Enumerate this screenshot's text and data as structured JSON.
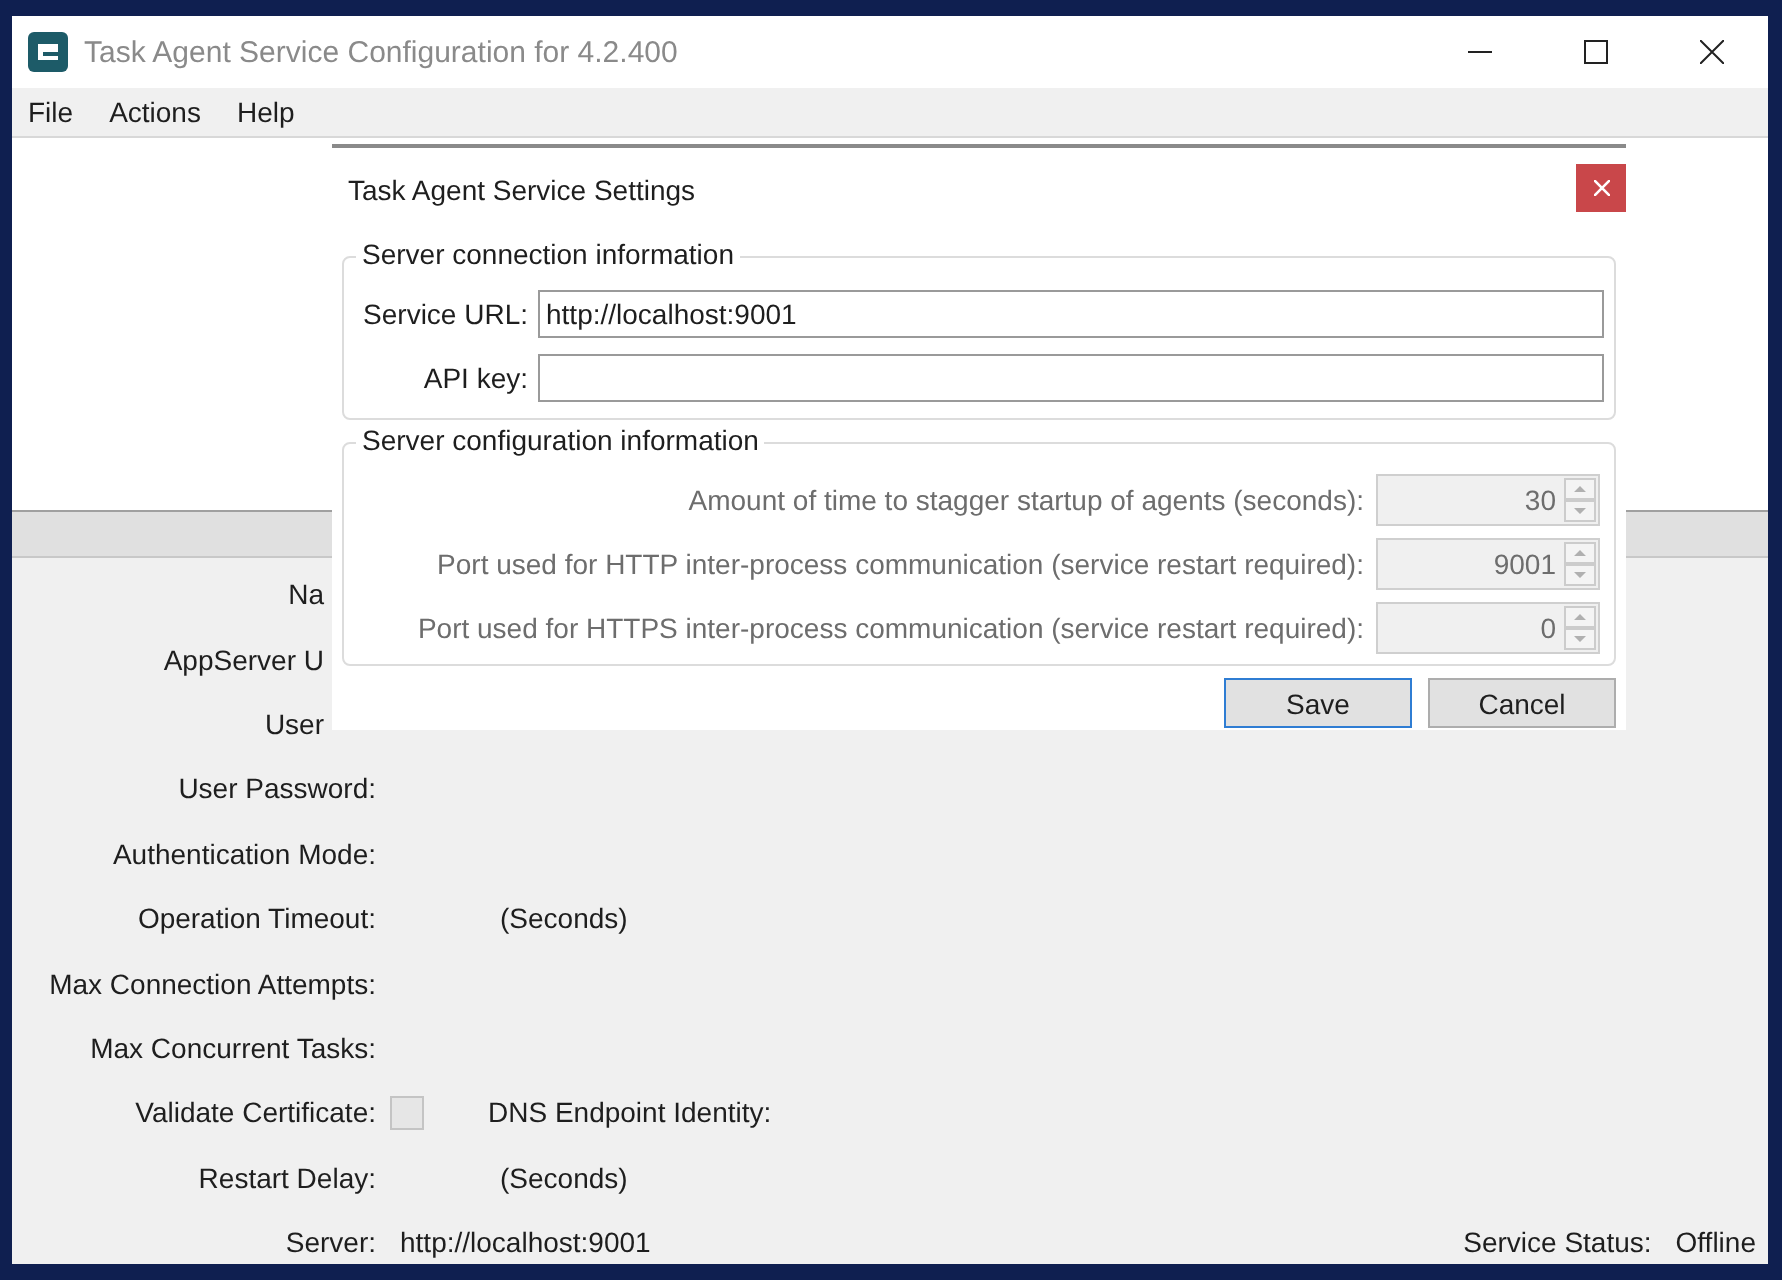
{
  "window": {
    "title": "Task Agent Service Configuration for 4.2.400"
  },
  "menu": [
    "File",
    "Actions",
    "Help"
  ],
  "form": {
    "rows": [
      {
        "kind": "clipped",
        "label": "Na"
      },
      {
        "kind": "clipped",
        "label": "AppServer U"
      },
      {
        "kind": "clipped",
        "label": "User"
      },
      {
        "kind": "plain",
        "label": "User Password:"
      },
      {
        "kind": "plain",
        "label": "Authentication Mode:"
      },
      {
        "kind": "suffix",
        "label": "Operation Timeout:",
        "suffix": "(Seconds)"
      },
      {
        "kind": "plain",
        "label": "Max Connection Attempts:"
      },
      {
        "kind": "plain",
        "label": "Max Concurrent Tasks:"
      },
      {
        "kind": "checkbox",
        "label": "Validate Certificate:",
        "checked": false,
        "extra_label": "DNS Endpoint Identity:"
      },
      {
        "kind": "suffix",
        "label": "Restart Delay:",
        "suffix": "(Seconds)"
      },
      {
        "kind": "status",
        "label": "Server:",
        "value": "http://localhost:9001",
        "status_label": "Service Status:",
        "status_value": "Offline"
      }
    ]
  },
  "dialog": {
    "title": "Task Agent Service Settings",
    "connection": {
      "title": "Server connection information",
      "fields": [
        {
          "label": "Service URL:",
          "value": "http://localhost:9001"
        },
        {
          "label": "API key:"
        }
      ]
    },
    "configuration": {
      "title": "Server configuration information",
      "spinners": [
        {
          "label": "Amount of time to stagger startup of agents (seconds):",
          "value": "30",
          "disabled": true
        },
        {
          "label": "Port used for HTTP inter-process communication (service restart required):",
          "value": "9001",
          "disabled": true
        },
        {
          "label": "Port used for HTTPS inter-process communication (service restart required):",
          "value": "0",
          "disabled": true
        }
      ]
    },
    "buttons": [
      {
        "label": "Save",
        "default": true
      },
      {
        "label": "Cancel",
        "default": false
      }
    ]
  }
}
